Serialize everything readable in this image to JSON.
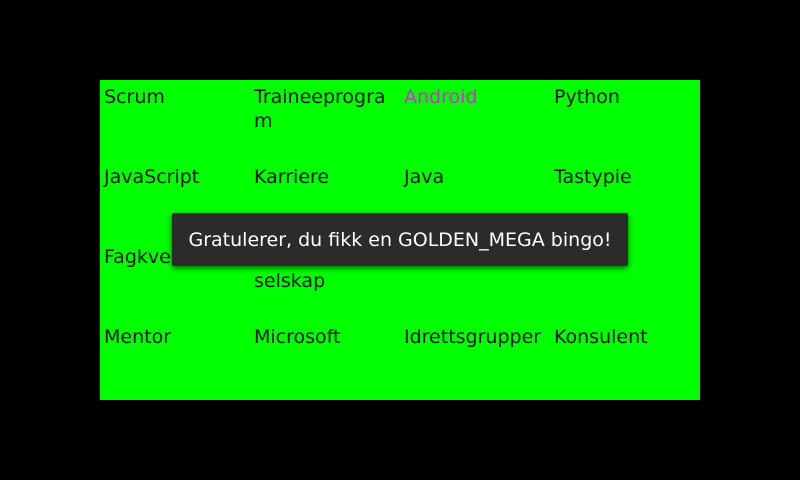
{
  "colors": {
    "background": "#000000",
    "board": "#00ff00",
    "text": "#111111",
    "highlight": "#cc33cc",
    "toast_bg": "#2b2b2b",
    "toast_text": "#ffffff"
  },
  "board": {
    "rows": [
      [
        "Scrum",
        "Traineeprogram",
        "Android",
        "Python"
      ],
      [
        "JavaScript",
        "Karriere",
        "Java",
        "Tastypie"
      ],
      [
        "Fagkveld",
        "selskap",
        "",
        ""
      ],
      [
        "Mentor",
        "Microsoft",
        "Idrettsgrupper",
        "Konsulent"
      ]
    ],
    "highlighted": "Android"
  },
  "toast": {
    "message": "Gratulerer, du fikk en GOLDEN_MEGA bingo!"
  }
}
